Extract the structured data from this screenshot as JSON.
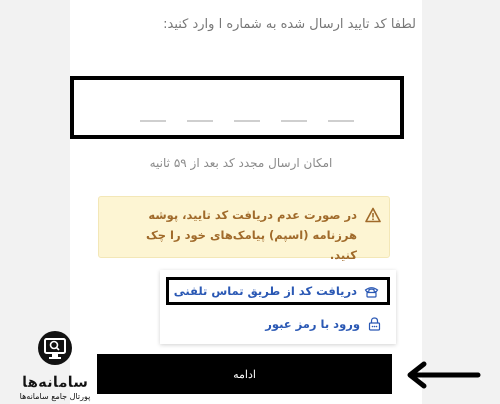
{
  "instruction": "لطفا کد تایید ارسال شده به شماره ا وارد کنید:",
  "resend_text": "امکان ارسال مجدد کد بعد از ۵۹ ثانیه",
  "warning": {
    "icon": "warning-triangle-icon",
    "text": "در صورت عدم دریافت کد تایید، پوشه هرزنامه (اسپم) پیامک‌های خود را چک کنید."
  },
  "menu": {
    "items": [
      {
        "label": "دریافت کد از طریق تماس تلفنی",
        "icon": "phone-icon",
        "selected": true
      },
      {
        "label": "ورود با رمز عبور",
        "icon": "password-lock-icon",
        "selected": false
      }
    ]
  },
  "continue_label": "ادامه",
  "logo": {
    "name": "سامانه‌ها",
    "tagline": "پورتال جامع سامانه‌ها"
  },
  "colors": {
    "link": "#2a58b4",
    "warning_bg": "#fdf5d3",
    "warning_text": "#a06a2a",
    "button_bg": "#000000"
  }
}
